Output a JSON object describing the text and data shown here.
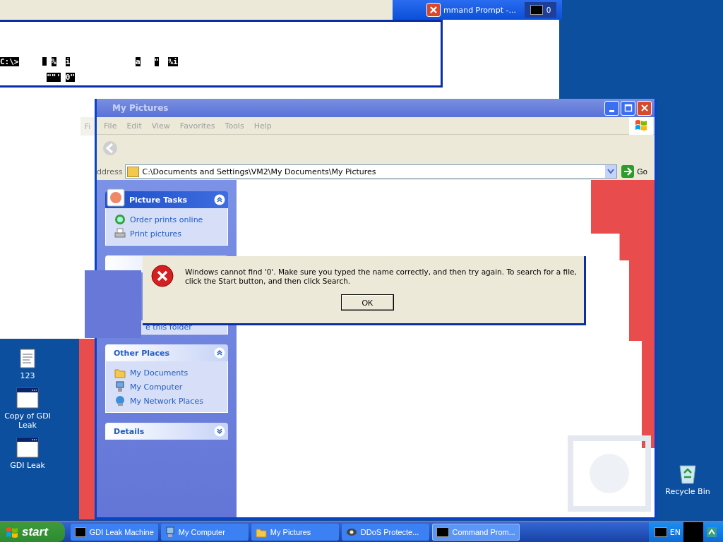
{
  "top_strip": {
    "title": "mmand Prompt -...",
    "task_button": "0"
  },
  "console": {
    "lines": [
      "C:\\>     _ %  i              a   \"  %i",
      "          \"\"' 0\""
    ]
  },
  "explorer": {
    "title": "My Pictures",
    "ghost_menu": "Fi",
    "menu": [
      "File",
      "Edit",
      "View",
      "Favorites",
      "Tools",
      "Help"
    ],
    "address": {
      "label": "ddress",
      "value": "C:\\Documents and Settings\\VM2\\My Documents\\My Pictures",
      "go": "Go"
    },
    "panels": [
      {
        "title": "Picture Tasks",
        "expanded": true,
        "kind": "picture",
        "items": [
          {
            "label": "Order prints online"
          },
          {
            "label": "Print pictures"
          }
        ]
      },
      {
        "expanded": true,
        "kind": "hidden",
        "items": [
          {
            "label": "e this folder"
          }
        ]
      },
      {
        "title": "Other Places",
        "expanded": true,
        "kind": "places",
        "items": [
          {
            "label": "My Documents"
          },
          {
            "label": "My Computer"
          },
          {
            "label": "My Network Places"
          }
        ]
      },
      {
        "title": "Details",
        "expanded": false,
        "kind": "places"
      }
    ]
  },
  "dialog": {
    "message": "Windows cannot find '0'. Make sure you typed the name correctly, and then try again. To search for a file, click the Start button, and then click Search.",
    "button": "OK"
  },
  "desktop_icons": [
    {
      "label": "123",
      "kind": "document"
    },
    {
      "label": "Copy of GDI Leak",
      "kind": "program"
    },
    {
      "label": "GDI Leak",
      "kind": "program"
    }
  ],
  "recycle_bin": {
    "label": "Recycle Bin"
  },
  "taskbar": {
    "start": "start",
    "tasks": [
      {
        "label": "GDI Leak Machine",
        "selected": false
      },
      {
        "label": "My Computer",
        "selected": false
      },
      {
        "label": "My Pictures",
        "selected": false
      },
      {
        "label": "DDoS Protecte...",
        "selected": false
      },
      {
        "label": "Command Prom...",
        "selected": true
      }
    ],
    "language": "EN"
  }
}
